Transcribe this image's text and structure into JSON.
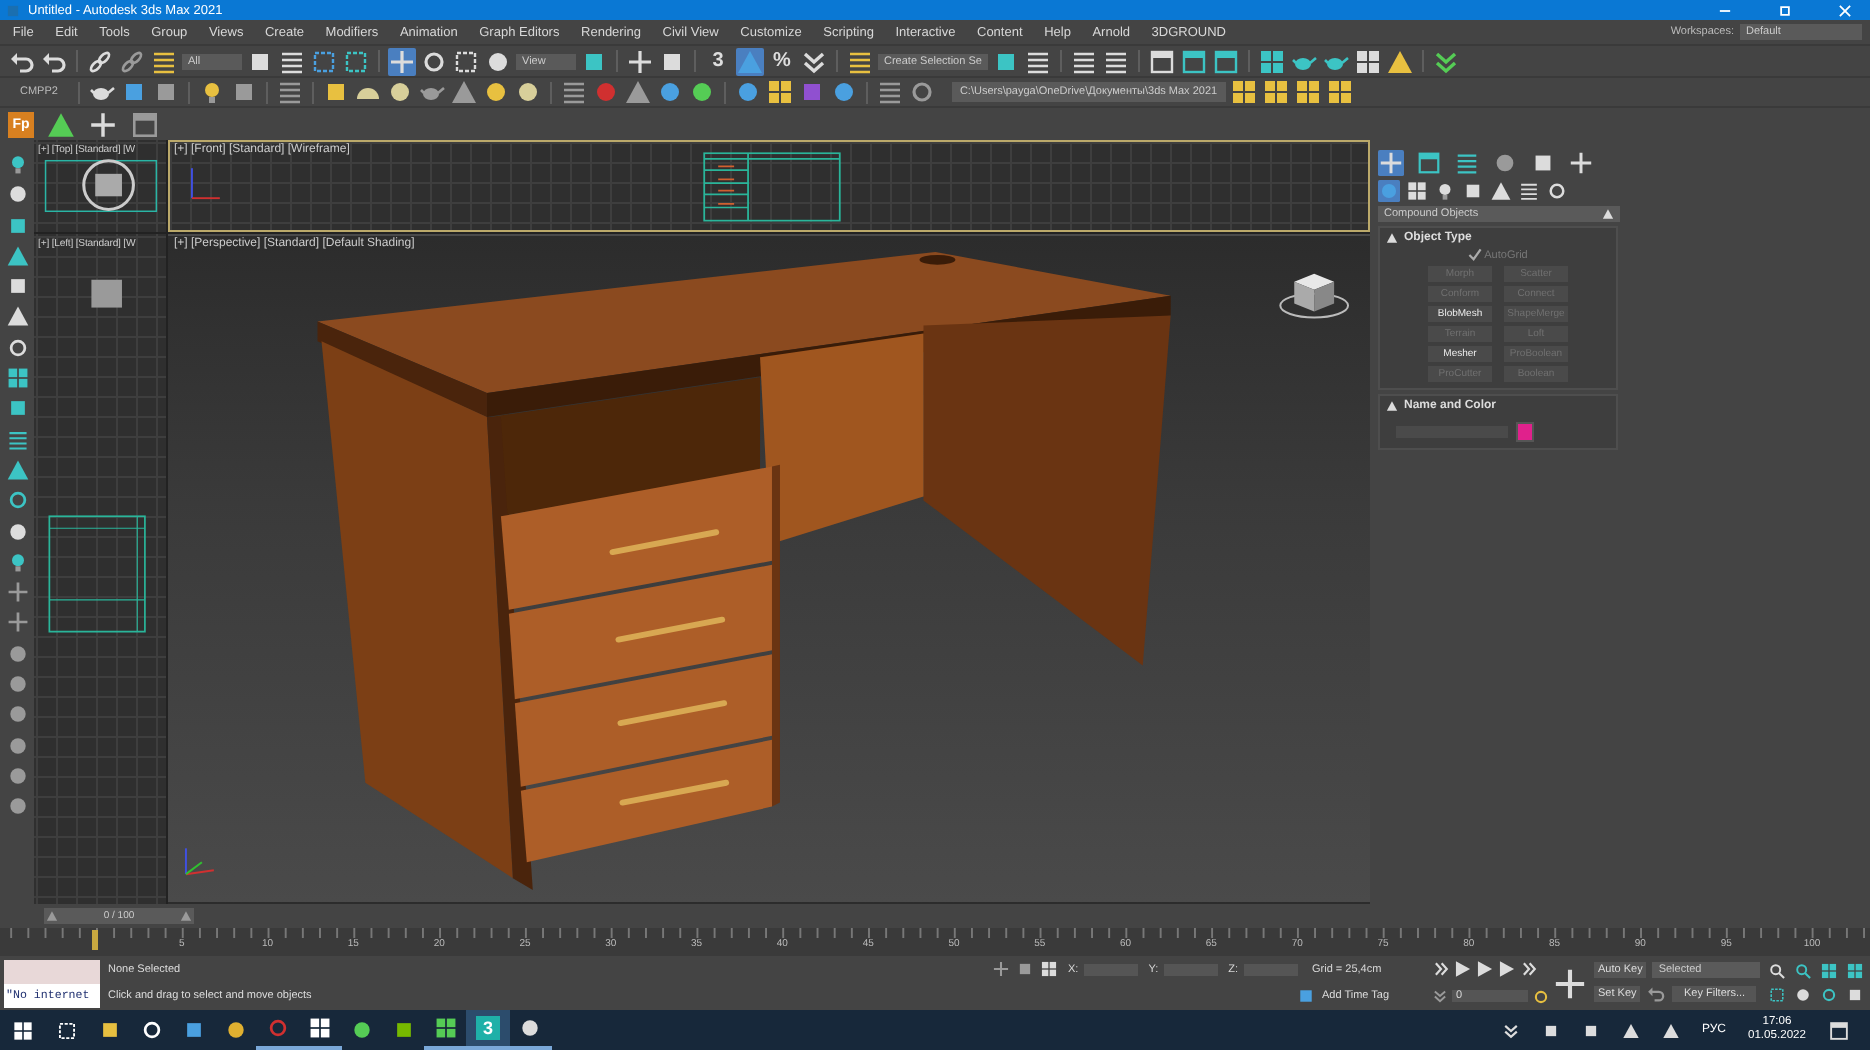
{
  "window": {
    "title": "Untitled - Autodesk 3ds Max 2021"
  },
  "menu": [
    "File",
    "Edit",
    "Tools",
    "Group",
    "Views",
    "Create",
    "Modifiers",
    "Animation",
    "Graph Editors",
    "Rendering",
    "Civil View",
    "Customize",
    "Scripting",
    "Interactive",
    "Content",
    "Help",
    "Arnold",
    "3DGROUND"
  ],
  "workspaces": {
    "label": "Workspaces:",
    "value": "Default"
  },
  "main_toolbar": [
    {
      "kind": "button",
      "selected": false
    },
    {
      "kind": "button",
      "selected": false
    },
    {
      "kind": "separator"
    },
    {
      "kind": "button",
      "selected": false
    },
    {
      "kind": "button",
      "selected": false
    },
    {
      "kind": "button",
      "selected": false
    },
    {
      "kind": "dropdown",
      "value": "All"
    },
    {
      "kind": "button",
      "selected": false
    },
    {
      "kind": "button",
      "selected": false
    },
    {
      "kind": "button",
      "selected": false
    },
    {
      "kind": "button",
      "selected": false
    },
    {
      "kind": "separator"
    },
    {
      "kind": "button",
      "selected": true
    },
    {
      "kind": "button",
      "selected": false
    },
    {
      "kind": "button",
      "selected": false
    },
    {
      "kind": "button",
      "selected": false
    },
    {
      "kind": "dropdown",
      "value": "View"
    },
    {
      "kind": "button",
      "selected": false
    },
    {
      "kind": "separator"
    },
    {
      "kind": "button",
      "selected": false
    },
    {
      "kind": "button",
      "selected": false
    },
    {
      "kind": "separator"
    },
    {
      "kind": "button",
      "selected": false,
      "badge": "3"
    },
    {
      "kind": "button",
      "selected": true
    },
    {
      "kind": "button",
      "selected": false,
      "badge": "%"
    },
    {
      "kind": "button",
      "selected": false
    },
    {
      "kind": "separator"
    },
    {
      "kind": "button",
      "selected": false
    },
    {
      "kind": "dropdown",
      "value": "Create Selection Se"
    },
    {
      "kind": "button",
      "selected": false
    },
    {
      "kind": "button",
      "selected": false
    },
    {
      "kind": "separator"
    },
    {
      "kind": "button",
      "selected": false
    },
    {
      "kind": "button",
      "selected": false
    },
    {
      "kind": "separator"
    },
    {
      "kind": "button",
      "selected": false
    },
    {
      "kind": "button",
      "selected": false
    },
    {
      "kind": "button",
      "selected": false
    },
    {
      "kind": "separator"
    },
    {
      "kind": "button",
      "selected": false
    },
    {
      "kind": "button",
      "selected": false
    },
    {
      "kind": "button",
      "selected": false
    },
    {
      "kind": "button",
      "selected": false
    },
    {
      "kind": "button",
      "selected": false
    },
    {
      "kind": "separator"
    },
    {
      "kind": "button",
      "selected": false
    }
  ],
  "second_toolbar": {
    "label": "CMPP2",
    "path": "C:\\Users\\payga\\OneDrive\\Документы\\3ds Max 2021"
  },
  "third_toolbar": {
    "badge": "Fp"
  },
  "viewports": [
    {
      "label": "[+] [Top] [Standard] [W",
      "active": false
    },
    {
      "label": "[+] [Front] [Standard] [Wireframe]",
      "active": true
    },
    {
      "label": "[+] [Left] [Standard] [W",
      "active": false
    },
    {
      "label": "[+] [Perspective] [Standard] [Default Shading]",
      "active": false
    }
  ],
  "command_panel": {
    "tabs": [
      {
        "selected": true
      },
      {
        "selected": false
      },
      {
        "selected": false
      },
      {
        "selected": false
      },
      {
        "selected": false
      },
      {
        "selected": false
      }
    ],
    "categories": [
      {
        "selected": true
      },
      {
        "selected": false
      },
      {
        "selected": false
      },
      {
        "selected": false
      },
      {
        "selected": false
      },
      {
        "selected": false
      },
      {
        "selected": false
      }
    ],
    "category": "Compound Objects",
    "object_type": {
      "title": "Object Type",
      "expanded": true,
      "autogrid": {
        "label": "AutoGrid",
        "checked": true,
        "disabled": true
      },
      "buttons": [
        {
          "label": "Morph",
          "disabled": true
        },
        {
          "label": "Scatter",
          "disabled": true
        },
        {
          "label": "Conform",
          "disabled": true
        },
        {
          "label": "Connect",
          "disabled": true
        },
        {
          "label": "BlobMesh",
          "disabled": false
        },
        {
          "label": "ShapeMerge",
          "disabled": true
        },
        {
          "label": "Terrain",
          "disabled": true
        },
        {
          "label": "Loft",
          "disabled": true
        },
        {
          "label": "Mesher",
          "disabled": false
        },
        {
          "label": "ProBoolean",
          "disabled": true
        },
        {
          "label": "ProCutter",
          "disabled": true
        },
        {
          "label": "Boolean",
          "disabled": true
        }
      ]
    },
    "name_and_color": {
      "title": "Name and Color",
      "expanded": true,
      "color": "#e0218c"
    }
  },
  "timeline": {
    "slider": {
      "text": "0 / 100",
      "level": 0
    },
    "labels": [
      "5",
      "10",
      "15",
      "20",
      "25",
      "30",
      "35",
      "40",
      "45",
      "50",
      "55",
      "60",
      "65",
      "70",
      "75",
      "80",
      "85",
      "90",
      "95",
      "100"
    ]
  },
  "status": {
    "maxscript": "\"No internet",
    "selection": "None Selected",
    "prompt": "Click and drag to select and move objects",
    "coords": [
      "X:",
      "Y:",
      "Z:"
    ],
    "grid": "Grid = 25,4cm",
    "time_tag": "Add Time Tag",
    "frame": "0",
    "auto_key": "Auto Key",
    "key_mode": "Selected",
    "set_key": "Set Key",
    "key_filters": "Key Filters..."
  },
  "taskbar": {
    "apps": [
      {
        "running": false,
        "selected": false
      },
      {
        "running": false,
        "selected": false
      },
      {
        "running": false,
        "selected": false
      },
      {
        "running": false,
        "selected": false
      },
      {
        "running": true,
        "selected": false
      },
      {
        "running": true,
        "selected": false
      },
      {
        "running": false,
        "selected": false
      },
      {
        "running": false,
        "selected": false
      },
      {
        "running": true,
        "selected": false
      },
      {
        "running": true,
        "selected": true,
        "badge": "3"
      },
      {
        "running": true,
        "selected": false
      }
    ],
    "language": "РУС",
    "time": "17:06",
    "date": "01.05.2022"
  }
}
